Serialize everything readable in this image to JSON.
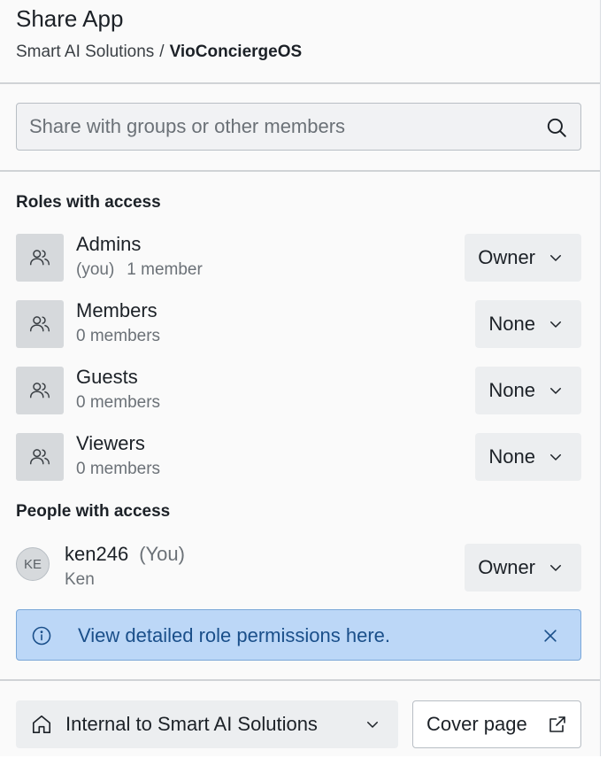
{
  "header": {
    "title": "Share App",
    "breadcrumb": {
      "org": "Smart AI Solutions",
      "separator": "/",
      "app": "VioConciergeOS"
    }
  },
  "search": {
    "placeholder": "Share with groups or other members",
    "value": "",
    "icon": "search-icon"
  },
  "roles_section": {
    "label": "Roles with access",
    "roles": [
      {
        "name": "Admins",
        "you": "(you)",
        "members": "1 member",
        "permission": "Owner",
        "icon": "users-icon"
      },
      {
        "name": "Members",
        "you": "",
        "members": "0 members",
        "permission": "None",
        "icon": "users-icon"
      },
      {
        "name": "Guests",
        "you": "",
        "members": "0 members",
        "permission": "None",
        "icon": "users-icon"
      },
      {
        "name": "Viewers",
        "you": "",
        "members": "0 members",
        "permission": "None",
        "icon": "users-icon"
      }
    ]
  },
  "people_section": {
    "label": "People with access",
    "people": [
      {
        "initials": "KE",
        "username": "ken246",
        "you": "(You)",
        "display_name": "Ken",
        "permission": "Owner"
      }
    ]
  },
  "callout": {
    "text": "View detailed role permissions ",
    "link": "here",
    "suffix": ".",
    "icon": "info-icon",
    "colors": {
      "background": "#bcd7f7",
      "text": "#1a4f8a"
    }
  },
  "footer": {
    "visibility": "Internal to Smart AI Solutions",
    "visibility_icon": "home-icon",
    "cover_button": "Cover page",
    "cover_icon": "external-link-icon"
  }
}
